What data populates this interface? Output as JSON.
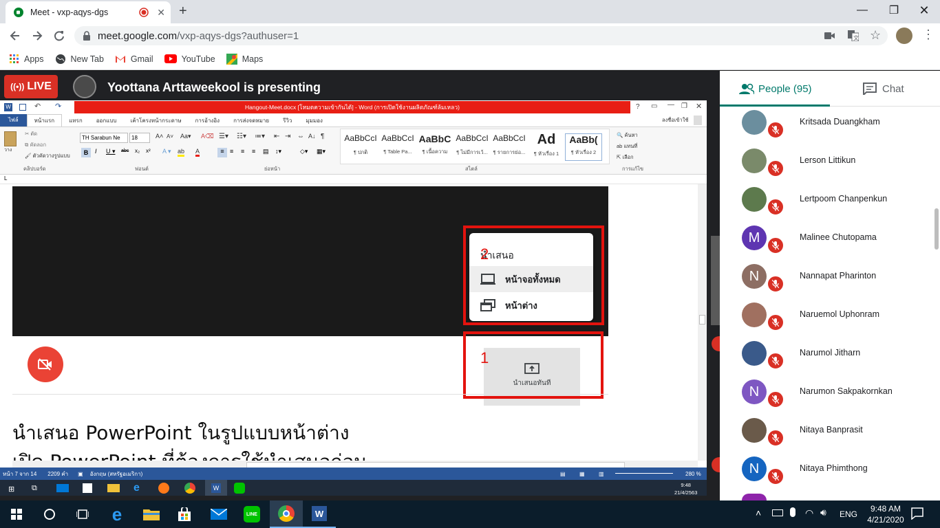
{
  "browser": {
    "tab_title": "Meet - vxp-aqys-dgs",
    "url_host": "meet.google.com",
    "url_path": "/vxp-aqys-dgs?authuser=1",
    "bookmarks": [
      "Apps",
      "New Tab",
      "Gmail",
      "YouTube",
      "Maps"
    ]
  },
  "meet": {
    "live_label": "LIVE",
    "presenter_text": "Yoottana Arttaweekool is presenting"
  },
  "word": {
    "title_bar": "Hangout-Meet.docx [โหมดความเข้ากันได้] - Word (การเปิดใช้งานผลิตภัณฑ์ล้มเหลว)",
    "file_tab": "ไฟล์",
    "home_tab": "หน้าแรก",
    "tabs": [
      "แทรก",
      "ออกแบบ",
      "เค้าโครงหน้ากระดาษ",
      "การอ้างอิง",
      "การส่งจดหมาย",
      "รีวิว",
      "มุมมอง"
    ],
    "signin": "ลงชื่อเข้าใช้",
    "clipboard": {
      "cut": "ตัด",
      "copy": "คัดลอก",
      "format_painter": "ตัวคัดวางรูปแบบ",
      "paste": "วาง",
      "group": "คลิปบอร์ด"
    },
    "font": {
      "name": "TH Sarabun Ne",
      "size": "18",
      "group": "ฟอนต์"
    },
    "paragraph_group": "ย่อหน้า",
    "styles_group": "สไตล์",
    "styles": [
      {
        "sample": "AaBbCcI",
        "name": "¶ ปกติ"
      },
      {
        "sample": "AaBbCcI",
        "name": "¶ Table Pa..."
      },
      {
        "sample": "AaBbC",
        "name": "¶ เนื้อความ"
      },
      {
        "sample": "AaBbCcI",
        "name": "¶ ไม่มีการเว้..."
      },
      {
        "sample": "AaBbCcI",
        "name": "¶ รายการย่อ..."
      },
      {
        "sample": "Ad",
        "name": "¶ หัวเรื่อง 1"
      },
      {
        "sample": "AaBb(",
        "name": "¶ หัวเรื่อง 2"
      }
    ],
    "editing": {
      "find": "ค้นหา",
      "replace": "แทนที่",
      "select": "เลือก",
      "group": "การแก้ไข"
    },
    "popup": {
      "heading": "นำเสนอ",
      "option1": "หน้าจอทั้งหมด",
      "option2": "หน้าต่าง"
    },
    "present_now": "นำเสนอทันที",
    "marker1": "1",
    "marker2": "2",
    "body_line1": "นำเสนอ PowerPoint ในรูปแบบหน้าต่าง",
    "body_line2": "เปิด PowerPoint ที่ต้องการใช้นำเสนอก่อน",
    "status": {
      "page": "หน้า 7 จาก 14",
      "words": "2209 คำ",
      "lang": "อังกฤษ (สหรัฐอเมริกา)",
      "zoom": "280 %"
    },
    "inner_time": "9:48",
    "inner_date": "21/4/2563"
  },
  "people_panel": {
    "people_tab": "People (95)",
    "chat_tab": "Chat",
    "participants": [
      {
        "name": "Kritsada Duangkham",
        "initial": "",
        "color": "#6b8e9e"
      },
      {
        "name": "Lerson Littikun",
        "initial": "",
        "color": "#7a8a6a"
      },
      {
        "name": "Lertpoom Chanpenkun",
        "initial": "",
        "color": "#5d7a4d"
      },
      {
        "name": "Malinee Chutopama",
        "initial": "M",
        "color": "#5e35b1"
      },
      {
        "name": "Nannapat Pharinton",
        "initial": "N",
        "color": "#8d6e63"
      },
      {
        "name": "Naruemol Uphonram",
        "initial": "",
        "color": "#a07060"
      },
      {
        "name": "Narumol Jitharn",
        "initial": "",
        "color": "#3a5a8a"
      },
      {
        "name": "Narumon Sakpakornkan",
        "initial": "N",
        "color": "#7e57c2"
      },
      {
        "name": "Nitaya Banprasit",
        "initial": "",
        "color": "#6a5a4a"
      },
      {
        "name": "Nitaya Phimthong",
        "initial": "N",
        "color": "#1565c0"
      }
    ]
  },
  "taskbar": {
    "lang": "ENG",
    "time": "9:48 AM",
    "date": "4/21/2020"
  }
}
